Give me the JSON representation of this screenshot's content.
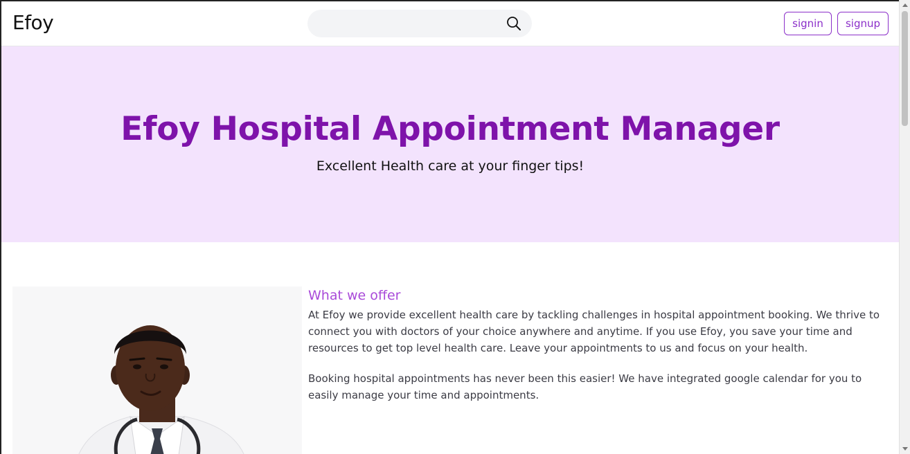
{
  "header": {
    "logo": "Efoy",
    "search": {
      "placeholder": "",
      "value": ""
    },
    "signin_label": "signin",
    "signup_label": "signup"
  },
  "hero": {
    "title": "Efoy Hospital Appointment Manager",
    "subtitle": "Excellent Health care at your finger tips!"
  },
  "offer": {
    "title": "What we offer",
    "paragraphs": [
      "At Efoy we provide excellent health care by tackling challenges in hospital appointment booking. We thrive to connect you with doctors of your choice anywhere and anytime. If you use Efoy, you save your time and resources to get top level health care. Leave your appointments to us and focus on your health.",
      "Booking hospital appointments has never been this easier! We have integrated google calendar for you to easily manage your time and appointments."
    ]
  },
  "colors": {
    "accent": "#7e13aa",
    "hero_bg": "#f3e3fd",
    "button_border": "#8b2fc9",
    "offer_title": "#a94ad9"
  },
  "icons": {
    "search": "search-icon"
  }
}
